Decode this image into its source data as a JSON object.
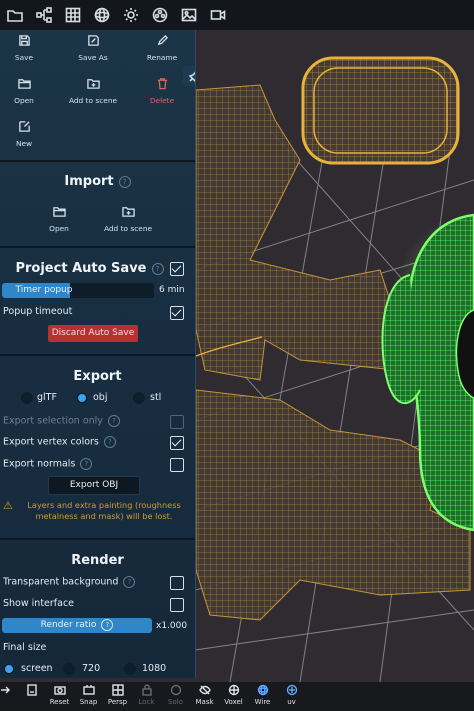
{
  "file_section": {
    "buttons": [
      {
        "label": "Save",
        "icon": "save-icon"
      },
      {
        "label": "Save As",
        "icon": "save-as-icon"
      },
      {
        "label": "Rename",
        "icon": "pencil-icon"
      },
      {
        "label": "Open",
        "icon": "folder-open-icon"
      },
      {
        "label": "Add to scene",
        "icon": "folder-add-icon"
      },
      {
        "label": "Delete",
        "icon": "trash-icon"
      },
      {
        "label": "New",
        "icon": "new-file-icon"
      }
    ]
  },
  "import_section": {
    "title": "Import",
    "help": "?",
    "open_label": "Open",
    "add_label": "Add to scene"
  },
  "autosave": {
    "title": "Project Auto Save",
    "help": "?",
    "enabled": true,
    "timer_label": "Timer popup",
    "timer_value": "6 min",
    "timer_fraction": 0.45,
    "popup_timeout_label": "Popup timeout",
    "popup_timeout_checked": true,
    "discard_label": "Discard Auto Save"
  },
  "export": {
    "title": "Export",
    "formats": [
      "glTF",
      "obj",
      "stl"
    ],
    "selected_format": "obj",
    "export_selection_label": "Export selection only",
    "export_vertex_colors_label": "Export vertex colors",
    "export_normals_label": "Export normals",
    "help": "?",
    "export_button_label": "Export OBJ",
    "warning_icon": "⚠",
    "warning": "Layers and extra painting (roughness metalness and mask) will be lost."
  },
  "render": {
    "title": "Render",
    "transparent_bg_label": "Transparent background",
    "show_interface_label": "Show interface",
    "help": "?",
    "ratio_label": "Render ratio",
    "ratio_value": "x1.000",
    "final_size_label": "Final size",
    "sizes": [
      "screen",
      "720",
      "1080"
    ]
  },
  "bottom_toolbar": {
    "items": [
      "Reset",
      "Snap",
      "Persp",
      "Lock",
      "Solo",
      "Mask",
      "Voxel",
      "Wire",
      "uv"
    ]
  },
  "colors": {
    "panel": "#1b3446",
    "accent": "#2f86c8",
    "danger": "#b63034",
    "warning": "#d29a2f",
    "mesh_orange": "#d9a13a",
    "mesh_green": "#4dff5a"
  }
}
